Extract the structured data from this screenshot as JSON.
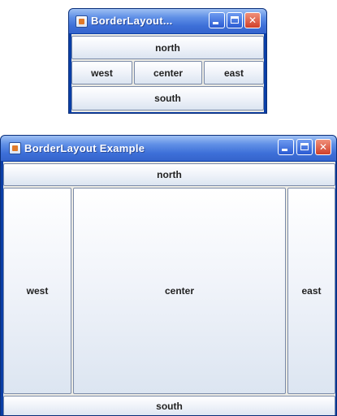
{
  "small_window": {
    "title": "BorderLayout...",
    "buttons": {
      "north": "north",
      "west": "west",
      "center": "center",
      "east": "east",
      "south": "south"
    }
  },
  "large_window": {
    "title": "BorderLayout Example",
    "buttons": {
      "north": "north",
      "west": "west",
      "center": "center",
      "east": "east",
      "south": "south"
    }
  }
}
